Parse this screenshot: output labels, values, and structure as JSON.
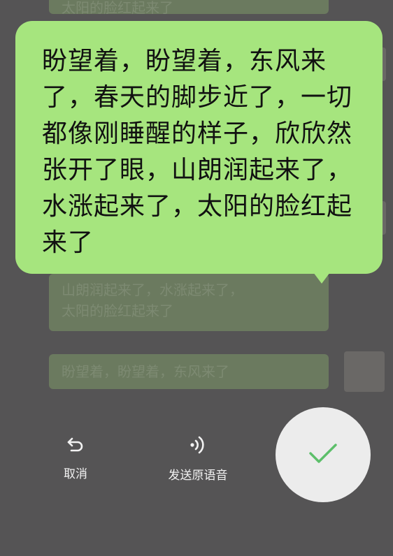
{
  "background_chat": {
    "top_text": "太阳的脸红起来了",
    "middle_lines": [
      "山朗润起来了，水涨起来了，",
      "太阳的脸红起来了"
    ],
    "bottom_text": "盼望着，盼望着，东风来了"
  },
  "voice_bubble": {
    "text": "盼望着，盼望着，东风来了，春天的脚步近了，一切都像刚睡醒的样子，欣欣然张开了眼，山朗润起来了，水涨起来了，太阳的脸红起来了"
  },
  "actions": {
    "cancel_label": "取消",
    "send_voice_label": "发送原语音"
  },
  "icons": {
    "cancel": "undo-arrow-icon",
    "send_voice": "voice-waves-icon",
    "confirm": "check-icon"
  },
  "colors": {
    "bubble": "#a6e57e",
    "confirm_check": "#5cbf6a",
    "overlay_bg": "#555455"
  }
}
